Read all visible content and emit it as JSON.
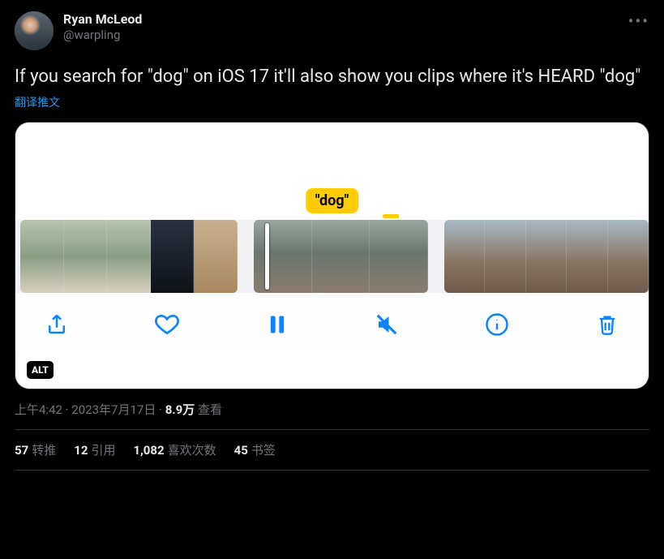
{
  "author": {
    "display_name": "Ryan McLeod",
    "handle": "@warpling"
  },
  "more_icon": "•••",
  "content": "If you search for \"dog\" on iOS 17 it'll also show you clips where it's HEARD \"dog\"",
  "translate_label": "翻译推文",
  "media": {
    "highlight_label": "\"dog\"",
    "alt_badge": "ALT",
    "toolbar": {
      "share": "share",
      "like": "like",
      "pause": "pause",
      "mute": "mute",
      "info": "info",
      "delete": "delete"
    }
  },
  "meta": {
    "time": "上午4:42",
    "dot1": " · ",
    "date": "2023年7月17日",
    "dot2": " · ",
    "views_num": "8.9万",
    "views_label": " 查看"
  },
  "stats": {
    "retweets_num": "57",
    "retweets_label": "转推",
    "quotes_num": "12",
    "quotes_label": "引用",
    "likes_num": "1,082",
    "likes_label": "喜欢次数",
    "bookmarks_num": "45",
    "bookmarks_label": "书签"
  }
}
